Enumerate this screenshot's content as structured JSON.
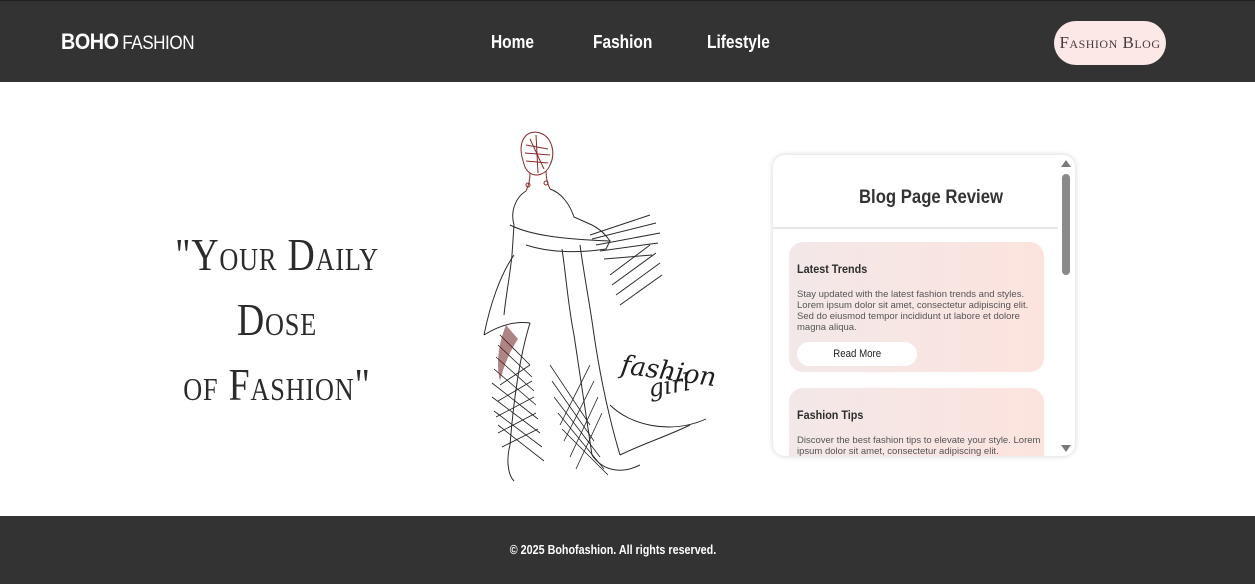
{
  "brand": {
    "bold": "BOHO",
    "light": "FASHION"
  },
  "nav": {
    "home": "Home",
    "fashion": "Fashion",
    "lifestyle": "Lifestyle"
  },
  "header_button": "Fashion Blog",
  "hero": {
    "quote_line1": "\"Your Daily Dose",
    "quote_line2": "of Fashion\""
  },
  "illustration": {
    "caption_line1": "fashion",
    "caption_line2": "girl"
  },
  "blog_panel": {
    "title": "Blog Page Review",
    "cards": [
      {
        "title": "Latest Trends",
        "text": "Stay updated with the latest fashion trends and styles. Lorem ipsum dolor sit amet, consectetur adipiscing elit. Sed do eiusmod tempor incididunt ut labore et dolore magna aliqua.",
        "button": "Read More"
      },
      {
        "title": "Fashion Tips",
        "text": "Discover the best fashion tips to elevate your style. Lorem ipsum dolor sit amet, consectetur adipiscing elit."
      }
    ]
  },
  "footer": {
    "copyright": "© 2025 Bohofashion. All rights reserved."
  },
  "colors": {
    "header_bg": "#333333",
    "accent_pink": "#fde8e8",
    "card_gradient_end": "#fde3de",
    "text_dark": "#2b2b2b"
  }
}
